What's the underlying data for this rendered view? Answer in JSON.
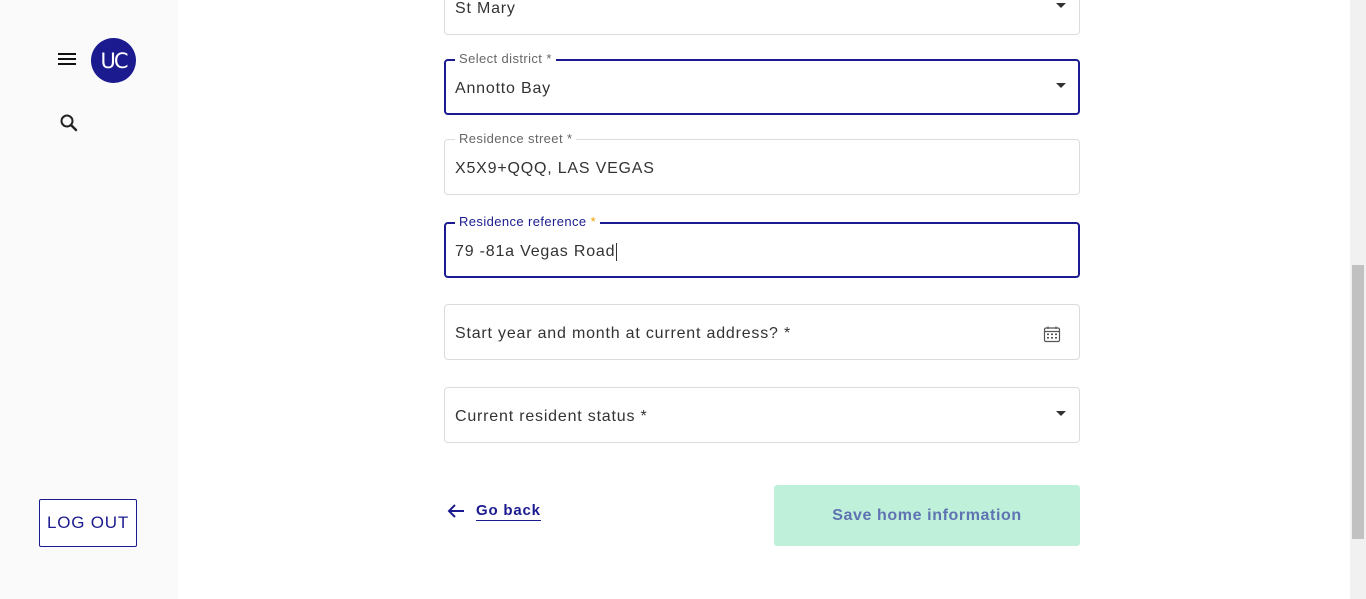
{
  "sidebar": {
    "menu_icon": "hamburger-menu-icon",
    "avatar_initials": "UC",
    "search_icon": "search-icon",
    "logout_label": "LOG OUT"
  },
  "form": {
    "parish": {
      "value": "St Mary"
    },
    "district": {
      "label": "Select district *",
      "value": "Annotto Bay"
    },
    "street": {
      "label": "Residence street *",
      "value": "X5X9+QQQ, LAS VEGAS"
    },
    "reference": {
      "label": "Residence reference",
      "required_mark": "*",
      "value": "79 -81a Vegas Road"
    },
    "start_date": {
      "placeholder": "Start year and month at current address? *",
      "icon": "calendar-icon"
    },
    "resident_status": {
      "placeholder": "Current resident status *"
    }
  },
  "actions": {
    "go_back_label": "Go back",
    "save_label": "Save home information"
  },
  "colors": {
    "primary": "#1b1b8f",
    "required_star": "#f0a000",
    "save_button_bg": "#bff0da",
    "save_button_text": "#5f73b2"
  }
}
